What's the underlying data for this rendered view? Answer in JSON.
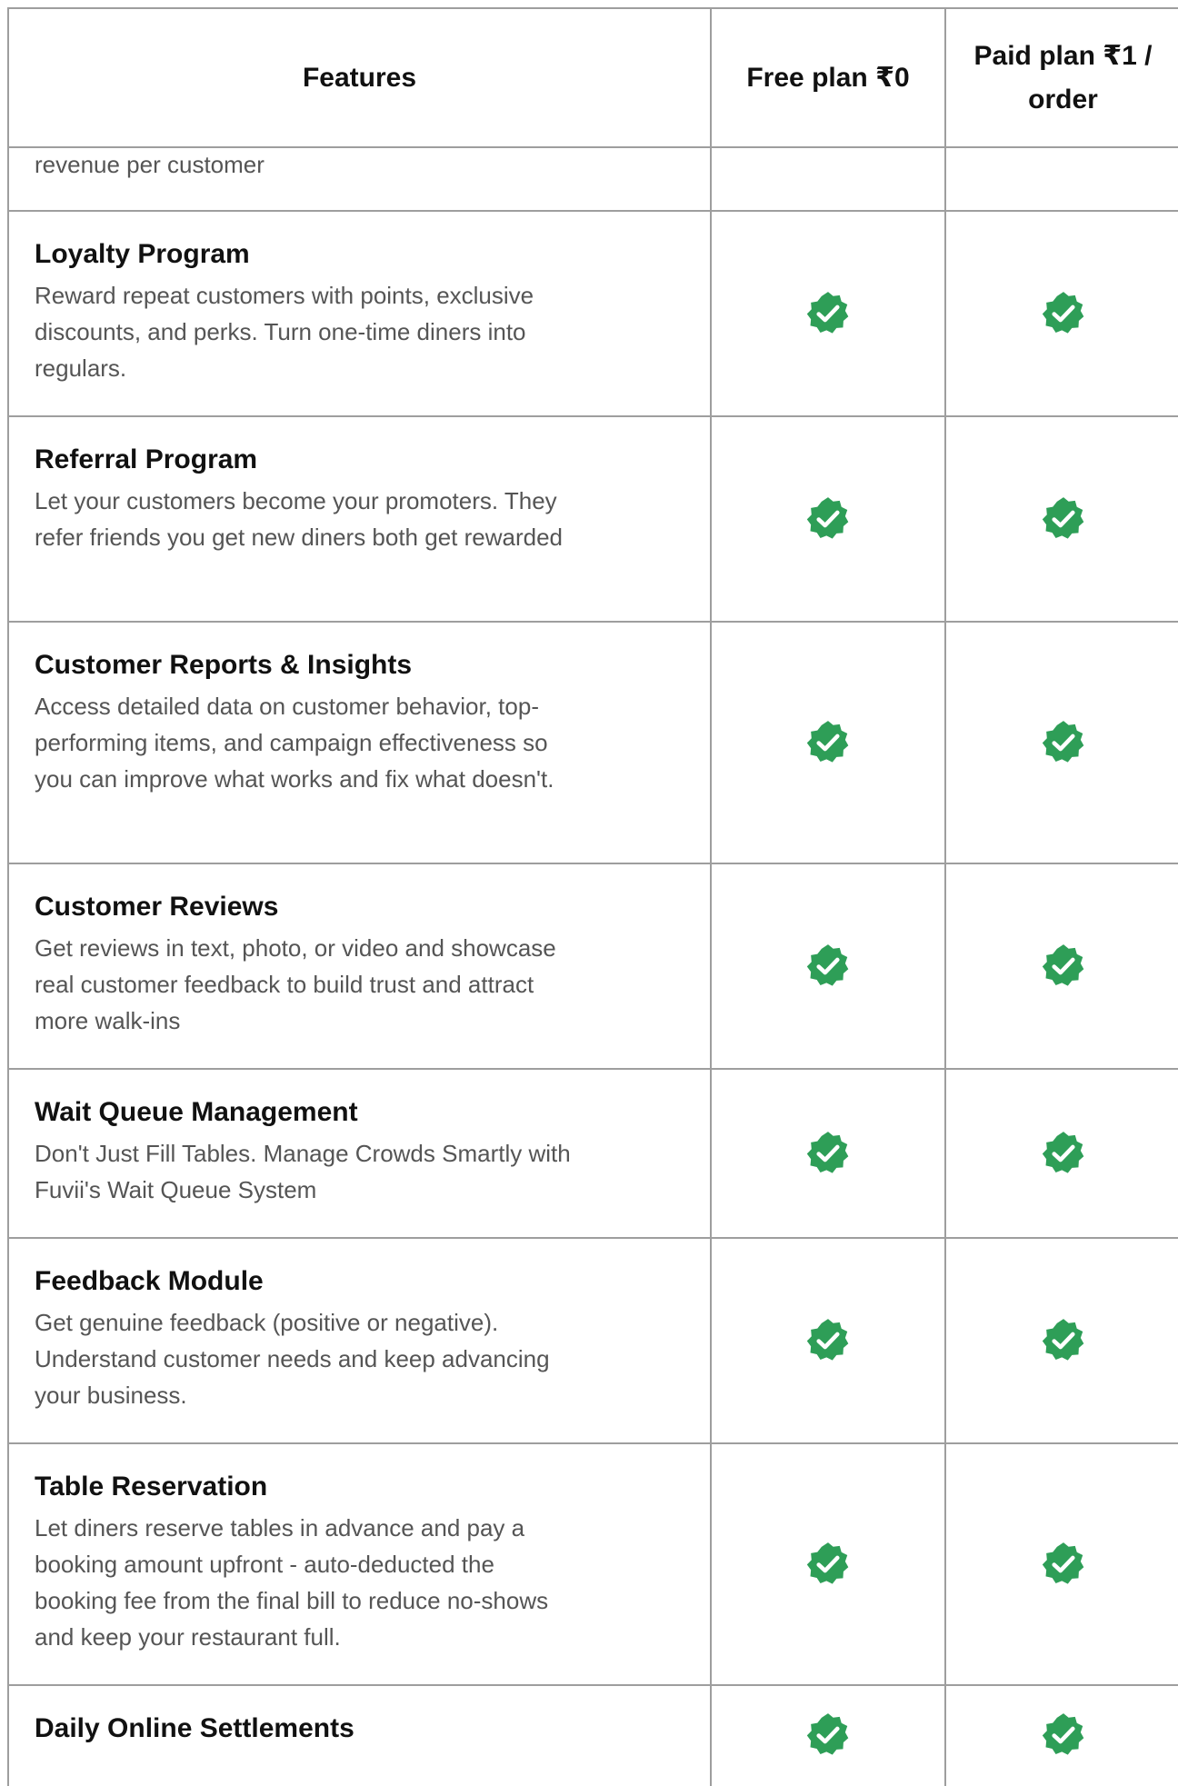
{
  "table": {
    "headers": {
      "features": "Features",
      "free": "Free plan ₹0",
      "paid": "Paid plan ₹1 / order"
    },
    "partial_row": {
      "desc": "revenue per customer"
    },
    "rows": [
      {
        "name": "Loyalty Program",
        "desc": "Reward repeat customers with points, exclusive discounts, and perks. Turn one-time diners into regulars.",
        "free": true,
        "paid": true
      },
      {
        "name": "Referral Program",
        "desc": "Let your customers become your promoters. They refer friends you get new diners both get rewarded",
        "free": true,
        "paid": true
      },
      {
        "name": "Customer Reports & Insights",
        "desc": "Access detailed data on customer behavior, top-performing items, and campaign effectiveness so you can improve what works and fix what doesn't.",
        "free": true,
        "paid": true
      },
      {
        "name": "Customer Reviews",
        "desc": "Get reviews in text, photo, or video and showcase real customer feedback to build trust and attract more walk-ins",
        "free": true,
        "paid": true
      },
      {
        "name": "Wait Queue Management",
        "desc": "Don't Just Fill Tables. Manage Crowds Smartly with Fuvii's Wait Queue System",
        "free": true,
        "paid": true
      },
      {
        "name": "Feedback Module",
        "desc": "Get genuine feedback (positive or negative). Understand customer needs and keep advancing your business.",
        "free": true,
        "paid": true
      },
      {
        "name": "Table Reservation",
        "desc": "Let diners reserve tables in advance and pay a booking amount upfront - auto-deducted the booking fee from the final bill to reduce no-shows and keep your restaurant full.",
        "free": true,
        "paid": true
      },
      {
        "name": "Daily Online Settlements",
        "desc": "",
        "free": true,
        "paid": true
      }
    ]
  },
  "icons": {
    "included": "verified-check-badge-icon"
  },
  "colors": {
    "check_badge": "#2e9e57",
    "border": "#9e9e9e",
    "desc_text": "#555555"
  }
}
